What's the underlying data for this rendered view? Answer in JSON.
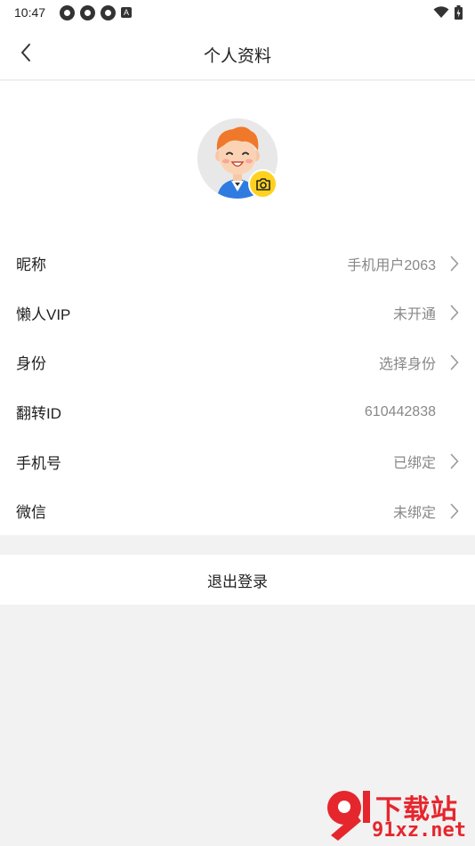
{
  "status_bar": {
    "time": "10:47",
    "notification_icons": [
      "app-notification-icon",
      "app-notification-icon",
      "app-notification-icon",
      "a-notification-icon"
    ],
    "right_icons": [
      "wifi-icon",
      "battery-icon"
    ]
  },
  "nav": {
    "title": "个人资料",
    "back_icon": "chevron-left-icon"
  },
  "avatar": {
    "image": "cartoon-avatar",
    "badge_icon": "camera-icon",
    "badge_color": "#ffd21f"
  },
  "rows": [
    {
      "label": "昵称",
      "value": "手机用户2063",
      "has_arrow": true
    },
    {
      "label": "懒人VIP",
      "value": "未开通",
      "has_arrow": true
    },
    {
      "label": "身份",
      "value": "选择身份",
      "has_arrow": true
    },
    {
      "label": "翻转ID",
      "value": "610442838",
      "has_arrow": false
    },
    {
      "label": "手机号",
      "value": "已绑定",
      "has_arrow": true
    },
    {
      "label": "微信",
      "value": "未绑定",
      "has_arrow": true
    }
  ],
  "logout_label": "退出登录",
  "watermark": {
    "top": "下载站",
    "bottom": "91xz.net",
    "color": "#e6262d"
  }
}
